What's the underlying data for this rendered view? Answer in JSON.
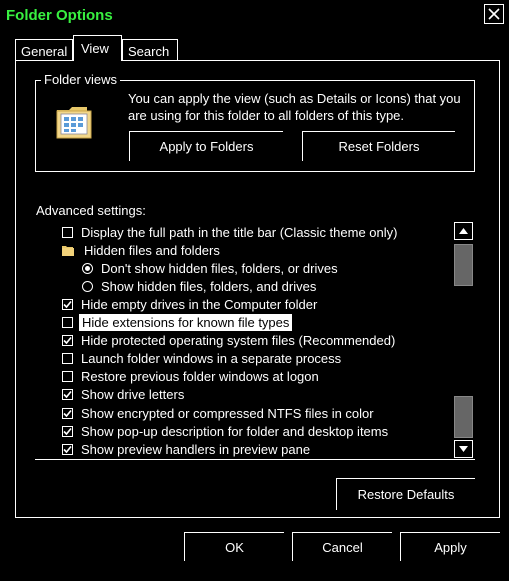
{
  "window": {
    "title": "Folder Options"
  },
  "tabs": [
    {
      "label": "General"
    },
    {
      "label": "View",
      "selected": true
    },
    {
      "label": "Search"
    }
  ],
  "folder_views": {
    "label": "Folder views",
    "description": "You can apply the view (such as Details or Icons) that you are using for this folder to all folders of this type.",
    "apply_label": "Apply to Folders",
    "reset_label": "Reset Folders"
  },
  "advanced": {
    "label": "Advanced settings:",
    "items": [
      {
        "type": "checkbox",
        "checked": false,
        "label": "Display the full path in the title bar (Classic theme only)"
      },
      {
        "type": "folder",
        "label": "Hidden files and folders"
      },
      {
        "type": "radio",
        "checked": true,
        "label": "Don't show hidden files, folders, or drives"
      },
      {
        "type": "radio",
        "checked": false,
        "label": "Show hidden files, folders, and drives"
      },
      {
        "type": "checkbox",
        "checked": true,
        "label": "Hide empty drives in the Computer folder"
      },
      {
        "type": "checkbox",
        "checked": false,
        "label": "Hide extensions for known file types",
        "focused": true
      },
      {
        "type": "checkbox",
        "checked": true,
        "label": "Hide protected operating system files (Recommended)"
      },
      {
        "type": "checkbox",
        "checked": false,
        "label": "Launch folder windows in a separate process"
      },
      {
        "type": "checkbox",
        "checked": false,
        "label": "Restore previous folder windows at logon"
      },
      {
        "type": "checkbox",
        "checked": true,
        "label": "Show drive letters"
      },
      {
        "type": "checkbox",
        "checked": true,
        "label": "Show encrypted or compressed NTFS files in color"
      },
      {
        "type": "checkbox",
        "checked": true,
        "label": "Show pop-up description for folder and desktop items"
      },
      {
        "type": "checkbox",
        "checked": true,
        "label": "Show preview handlers in preview pane"
      }
    ]
  },
  "buttons": {
    "restore_defaults": "Restore Defaults",
    "ok": "OK",
    "cancel": "Cancel",
    "apply": "Apply"
  },
  "colors": {
    "title": "#38f040",
    "background": "#000000",
    "text": "#ffffff"
  }
}
